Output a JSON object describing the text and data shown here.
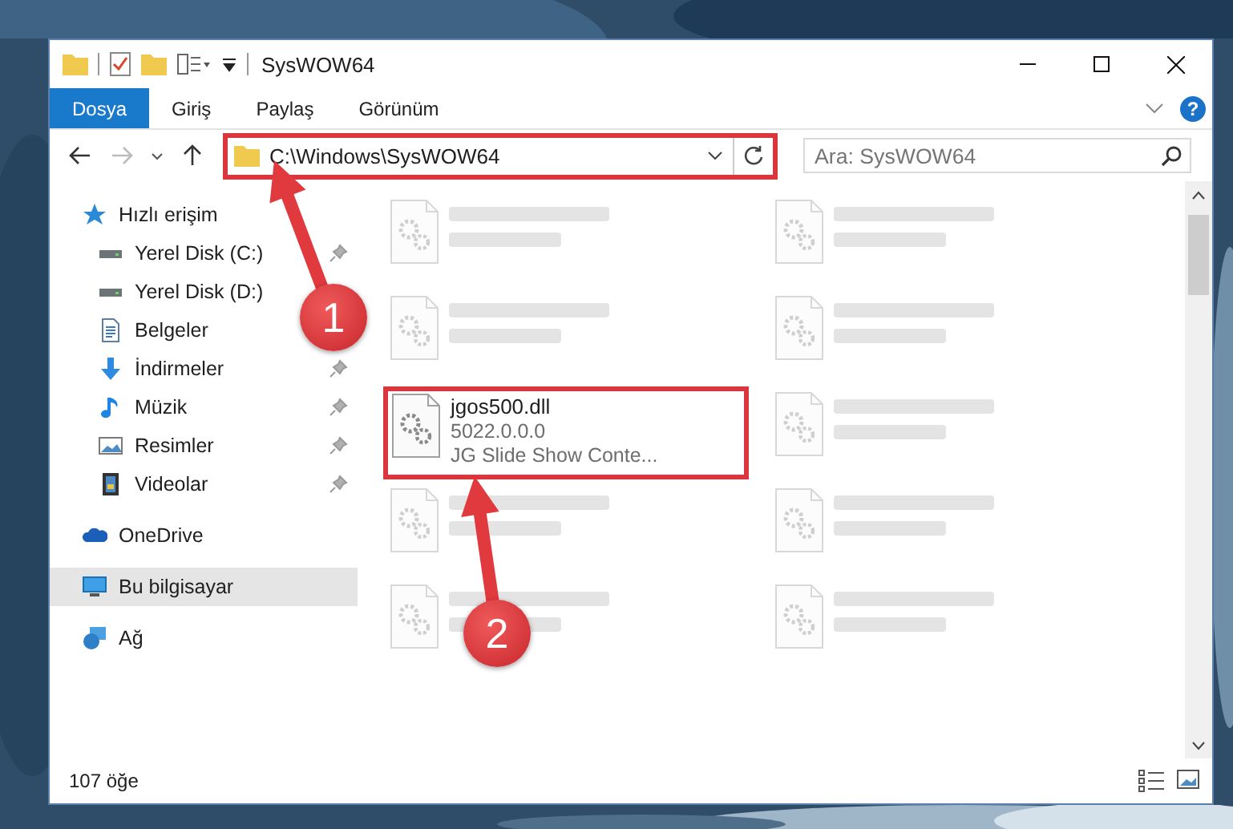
{
  "window": {
    "title": "SysWOW64"
  },
  "ribbon_tabs": [
    {
      "label": "Dosya",
      "selected": true
    },
    {
      "label": "Giriş",
      "selected": false
    },
    {
      "label": "Paylaş",
      "selected": false
    },
    {
      "label": "Görünüm",
      "selected": false
    }
  ],
  "help_label": "?",
  "address": {
    "path": "C:\\Windows\\SysWOW64",
    "highlighted": true
  },
  "search": {
    "placeholder": "Ara: SysWOW64"
  },
  "navigation": [
    {
      "label": "Hızlı erişim",
      "kind": "star",
      "selected": false,
      "children": [
        {
          "label": "Yerel Disk (C:)",
          "kind": "drive",
          "pinned": true,
          "selected": false
        },
        {
          "label": "Yerel Disk (D:)",
          "kind": "drive",
          "pinned": false,
          "selected": false
        },
        {
          "label": "Belgeler",
          "kind": "document",
          "pinned": false,
          "selected": false
        },
        {
          "label": "İndirmeler",
          "kind": "download",
          "pinned": true,
          "selected": false
        },
        {
          "label": "Müzik",
          "kind": "music",
          "pinned": true,
          "selected": false
        },
        {
          "label": "Resimler",
          "kind": "pictures",
          "pinned": true,
          "selected": false
        },
        {
          "label": "Videolar",
          "kind": "video",
          "pinned": true,
          "selected": false
        }
      ]
    },
    {
      "label": "OneDrive",
      "kind": "cloud",
      "selected": false
    },
    {
      "label": "Bu bilgisayar",
      "kind": "computer",
      "selected": true
    },
    {
      "label": "Ağ",
      "kind": "network",
      "selected": false
    }
  ],
  "files": [
    {
      "kind": "blurred"
    },
    {
      "kind": "blurred"
    },
    {
      "kind": "blurred"
    },
    {
      "kind": "blurred"
    },
    {
      "name": "jgos500.dll",
      "details": [
        "5022.0.0.0",
        "JG Slide Show Conte..."
      ],
      "kind": "highlighted"
    },
    {
      "kind": "blurred"
    },
    {
      "kind": "blurred"
    },
    {
      "kind": "blurred"
    },
    {
      "kind": "blurred"
    },
    {
      "kind": "blurred"
    }
  ],
  "status_bar": {
    "count": "107 öğe"
  },
  "annotations": [
    {
      "label": "1"
    },
    {
      "label": "2"
    }
  ]
}
